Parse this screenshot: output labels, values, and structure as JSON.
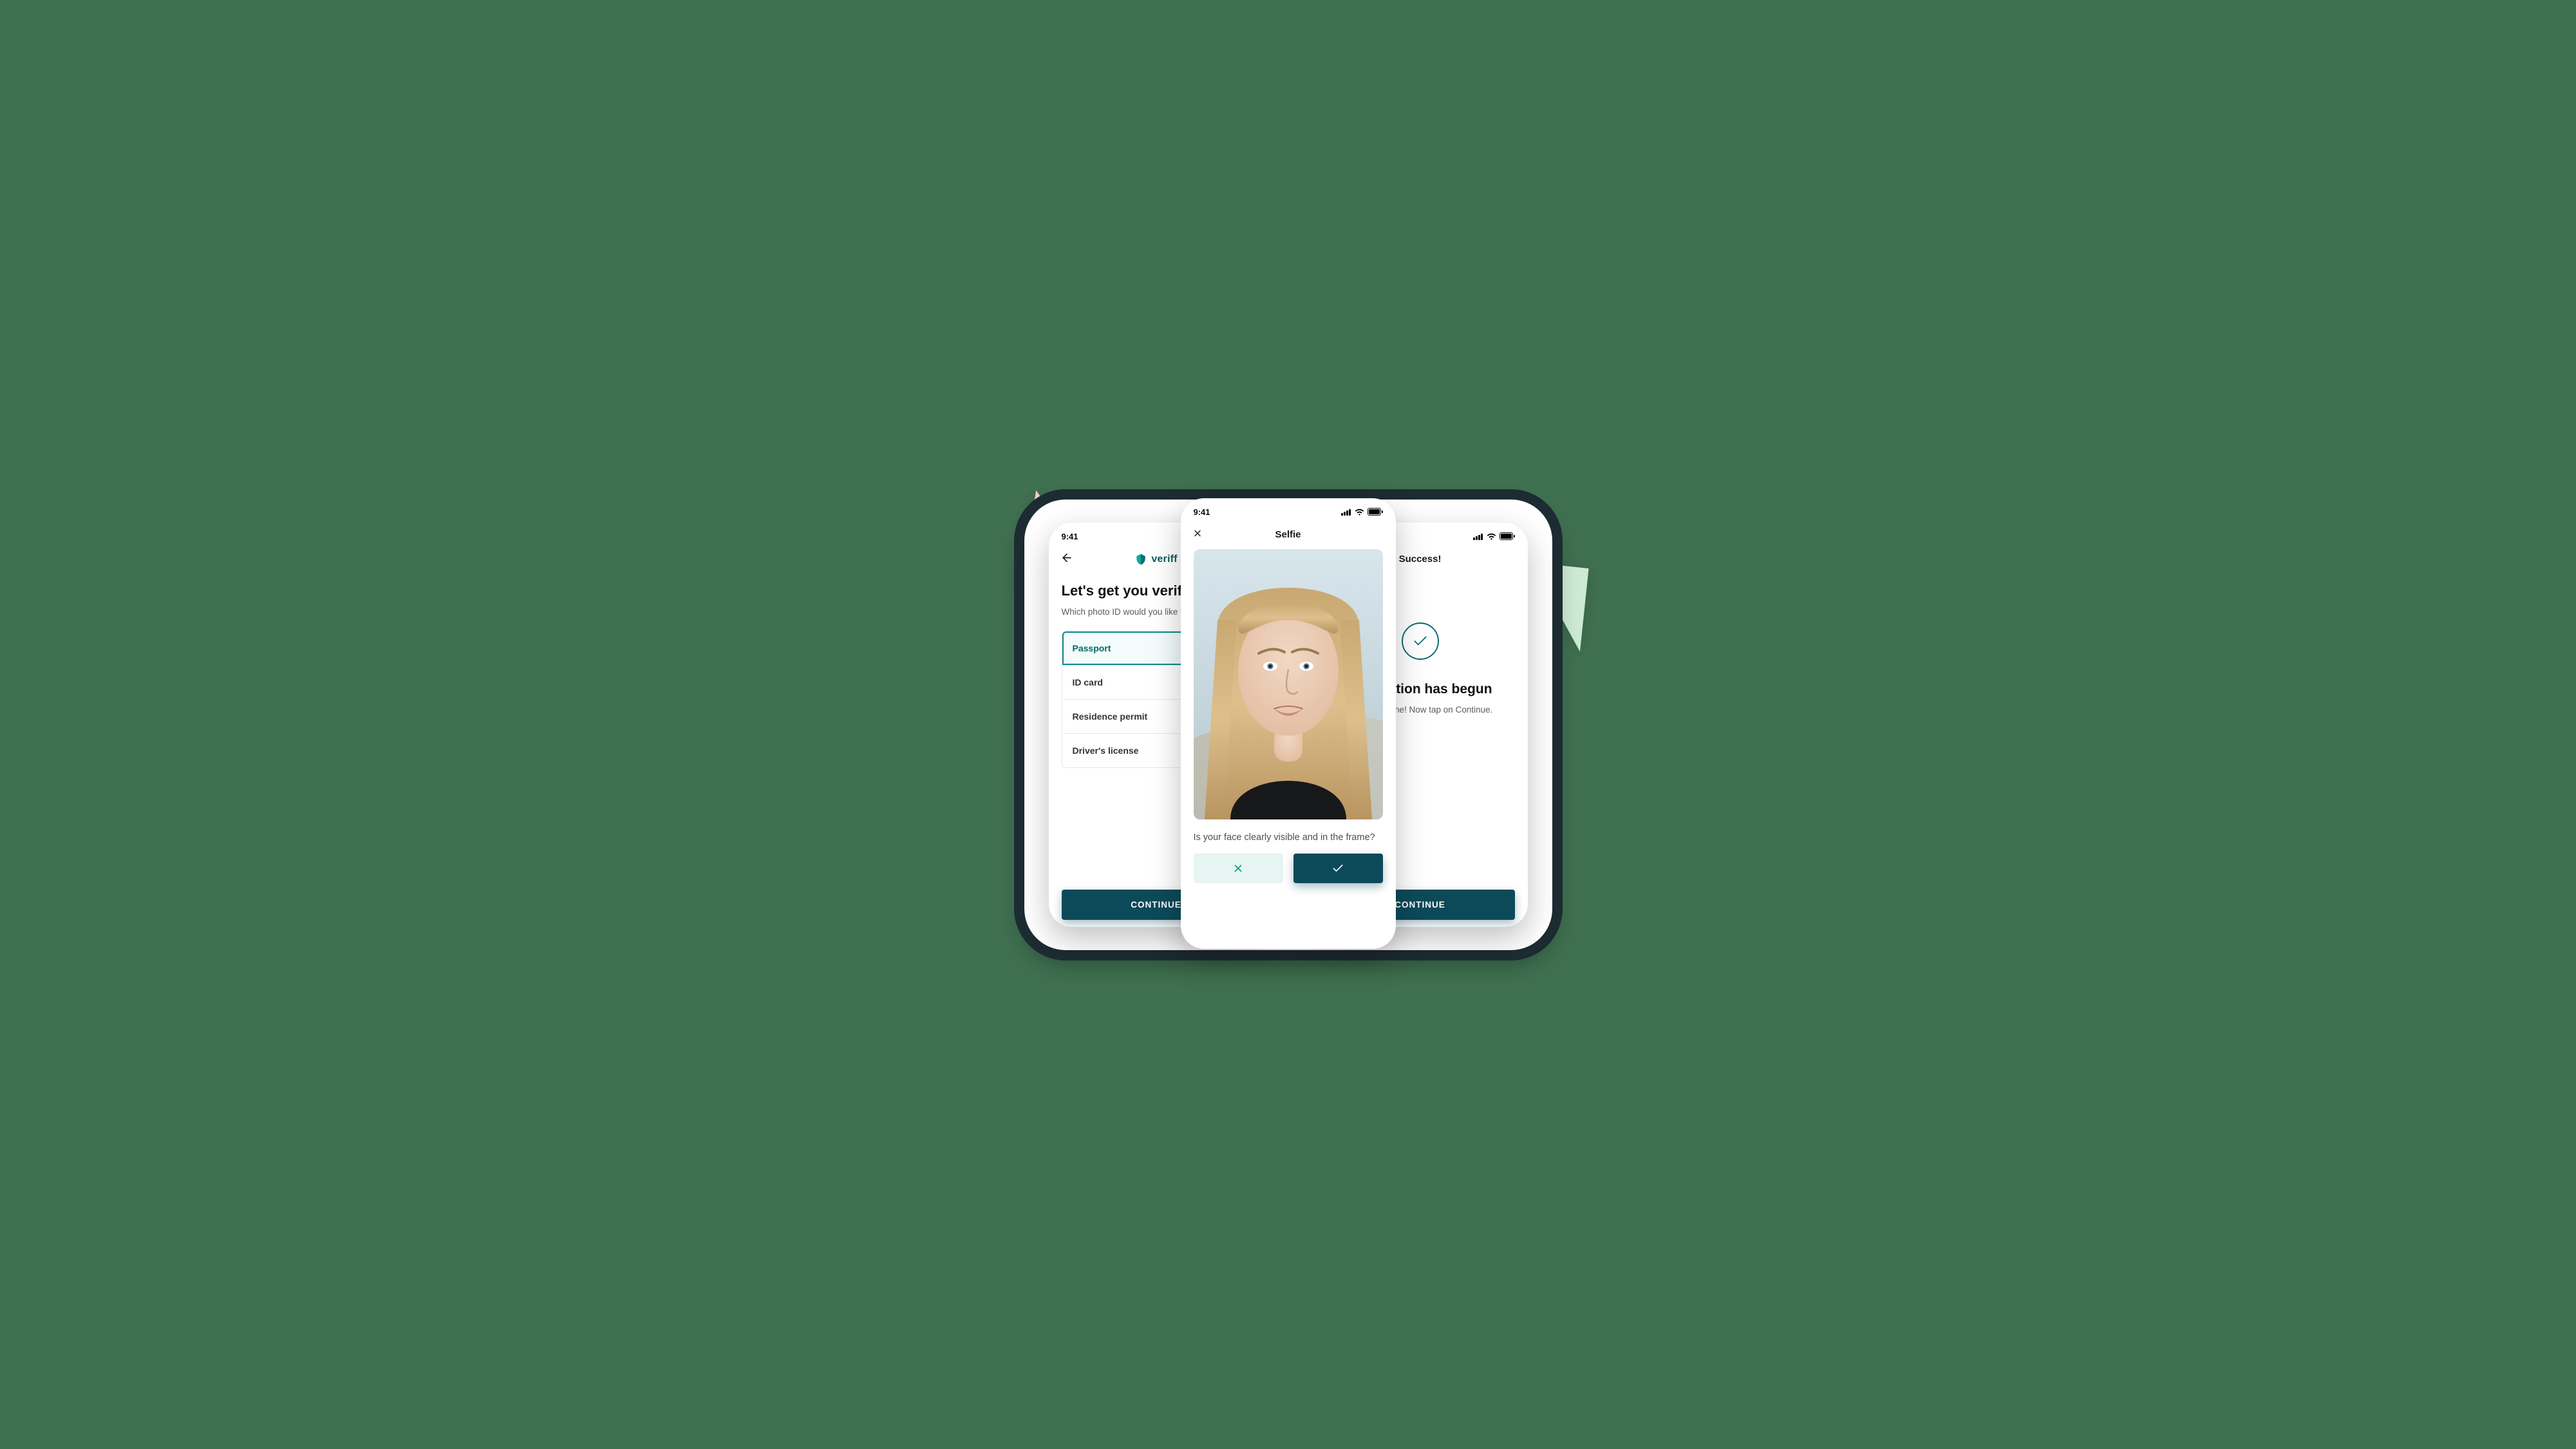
{
  "status": {
    "time": "9:41"
  },
  "left": {
    "brand": "veriff",
    "heading": "Let's get you verified",
    "sub": "Which photo ID would you like to use?",
    "options": [
      "Passport",
      "ID card",
      "Residence permit",
      "Driver's license"
    ],
    "cta": "CONTINUE"
  },
  "mid": {
    "title": "Selfie",
    "prompt": "Is your face clearly visible and in the frame?"
  },
  "right": {
    "title": "Success!",
    "heading": "Verification has begun",
    "sub": "You're all done! Now tap on Continue.",
    "cta": "CONTINUE"
  }
}
